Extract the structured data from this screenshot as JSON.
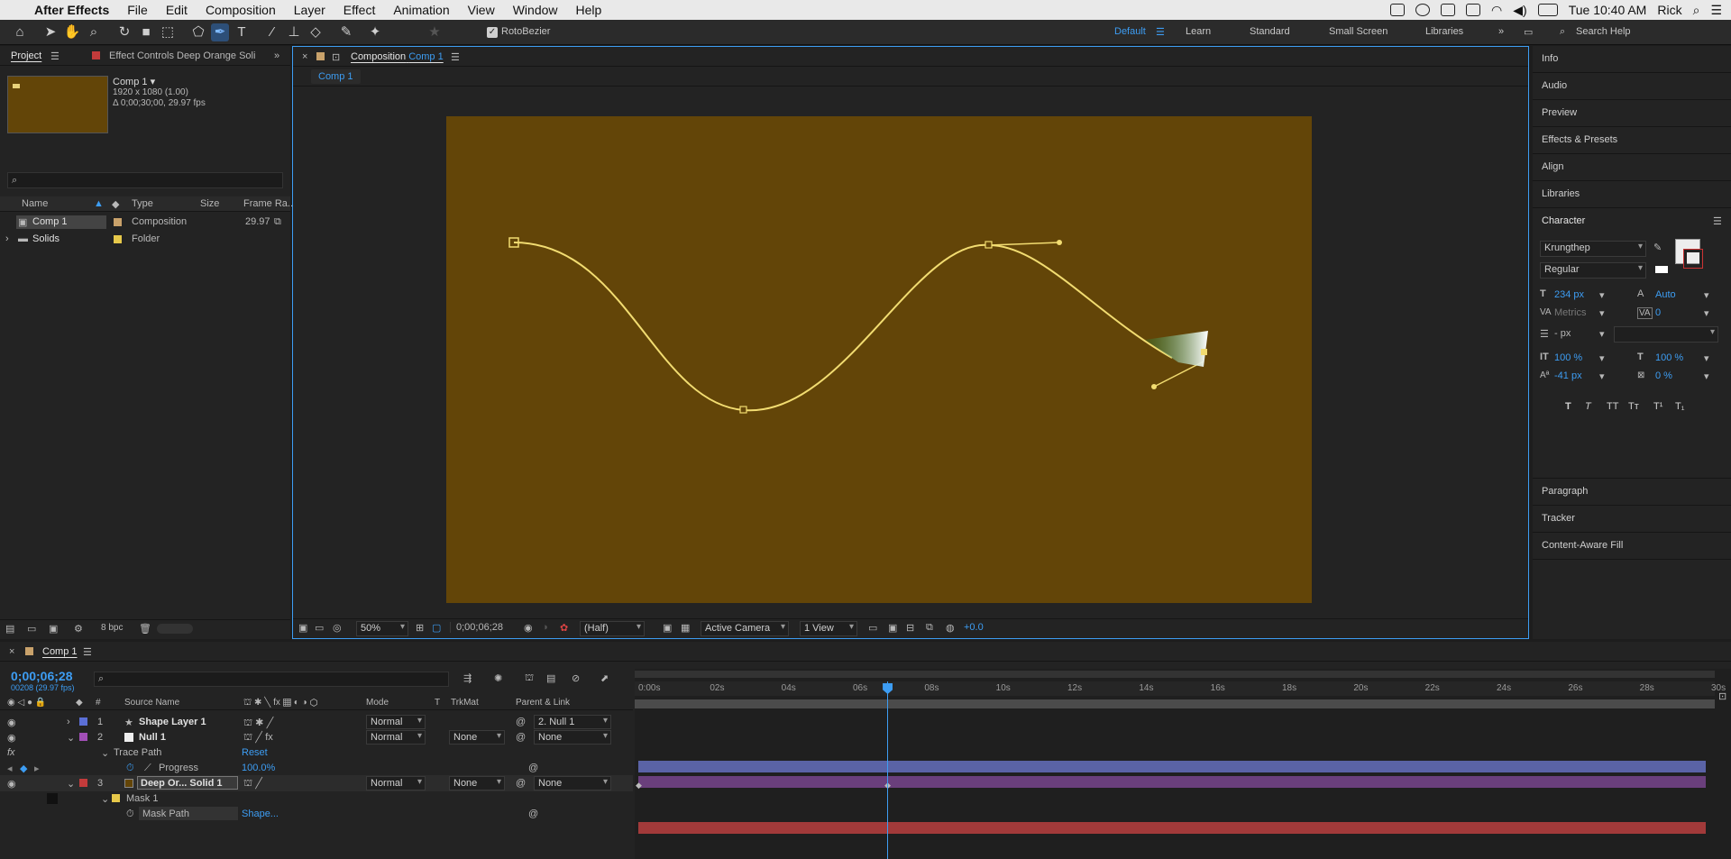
{
  "menubar": {
    "app": "After Effects",
    "items": [
      "File",
      "Edit",
      "Composition",
      "Layer",
      "Effect",
      "Animation",
      "View",
      "Window",
      "Help"
    ],
    "clock": "Tue 10:40 AM",
    "user": "Rick"
  },
  "toolbar": {
    "rotobezier_label": "RotoBezier",
    "workspaces": [
      "Default",
      "Learn",
      "Standard",
      "Small Screen",
      "Libraries"
    ],
    "active_workspace": "Default",
    "search_placeholder": "Search Help"
  },
  "project_panel": {
    "tab_project": "Project",
    "tab_effect_controls": "Effect Controls Deep Orange Soli",
    "preview_name": "Comp 1 ▾",
    "preview_dims": "1920 x 1080 (1.00)",
    "preview_duration": "Δ 0;00;30;00, 29.97 fps",
    "search_placeholder": "",
    "columns": [
      "Name",
      "Type",
      "Size",
      "Frame Ra..."
    ],
    "items": [
      {
        "name": "Comp 1",
        "type": "Composition",
        "size": "",
        "fps": "29.97",
        "color": "#c9a26b"
      },
      {
        "name": "Solids",
        "type": "Folder",
        "size": "",
        "fps": "",
        "color": "#e6c84a"
      }
    ],
    "bpc": "8 bpc"
  },
  "composition_panel": {
    "tab_label": "Composition",
    "tab_comp": "Comp 1",
    "subtab": "Comp 1",
    "bg_color": "#634508",
    "zoom": "50%",
    "timecode": "0;00;06;28",
    "resolution": "(Half)",
    "camera": "Active Camera",
    "views": "1 View",
    "exposure": "+0.0"
  },
  "right_panel": {
    "items": [
      "Info",
      "Audio",
      "Preview",
      "Effects & Presets",
      "Align",
      "Libraries"
    ],
    "character": {
      "title": "Character",
      "font": "Krungthep",
      "style": "Regular",
      "size": "234 px",
      "leading": "Auto",
      "kerning": "Metrics",
      "tracking": "0",
      "stroke": "- px",
      "vscale": "100 %",
      "hscale": "100 %",
      "baseline": "-41 px",
      "tsume": "0 %",
      "styles": [
        "T",
        "T",
        "TT",
        "Tт",
        "T¹",
        "T₁"
      ]
    },
    "items_bottom": [
      "Paragraph",
      "Tracker",
      "Content-Aware Fill"
    ]
  },
  "timeline": {
    "tab": "Comp 1",
    "timecode": "0;00;06;28",
    "frames": "00208 (29.97 fps)",
    "headers": {
      "source": "Source Name",
      "mode": "Mode",
      "t": "T",
      "trkmat": "TrkMat",
      "parent": "Parent & Link"
    },
    "ruler": [
      "0:00s",
      "02s",
      "04s",
      "06s",
      "08s",
      "10s",
      "12s",
      "14s",
      "16s",
      "18s",
      "20s",
      "22s",
      "24s",
      "26s",
      "28s",
      "30s"
    ],
    "layers": [
      {
        "num": "1",
        "name": "Shape Layer 1",
        "color": "#5b6fd6",
        "mode": "Normal",
        "trkmat": "",
        "parent": "2. Null 1",
        "bar": "#5a63a6"
      },
      {
        "num": "2",
        "name": "Null 1",
        "color": "#a24fb7",
        "mode": "Normal",
        "trkmat": "None",
        "parent": "None",
        "bar": "#6a3f7c"
      },
      {
        "num": "3",
        "name": "Deep Or... Solid 1",
        "color": "#c33b3b",
        "mode": "Normal",
        "trkmat": "None",
        "parent": "None",
        "bar": "#a23a3a"
      }
    ],
    "trace_path": "Trace Path",
    "reset": "Reset",
    "progress_label": "Progress",
    "progress_value": "100.0%",
    "mask": "Mask 1",
    "mask_path": "Mask Path",
    "shape": "Shape...",
    "playhead_fraction": 0.232
  }
}
